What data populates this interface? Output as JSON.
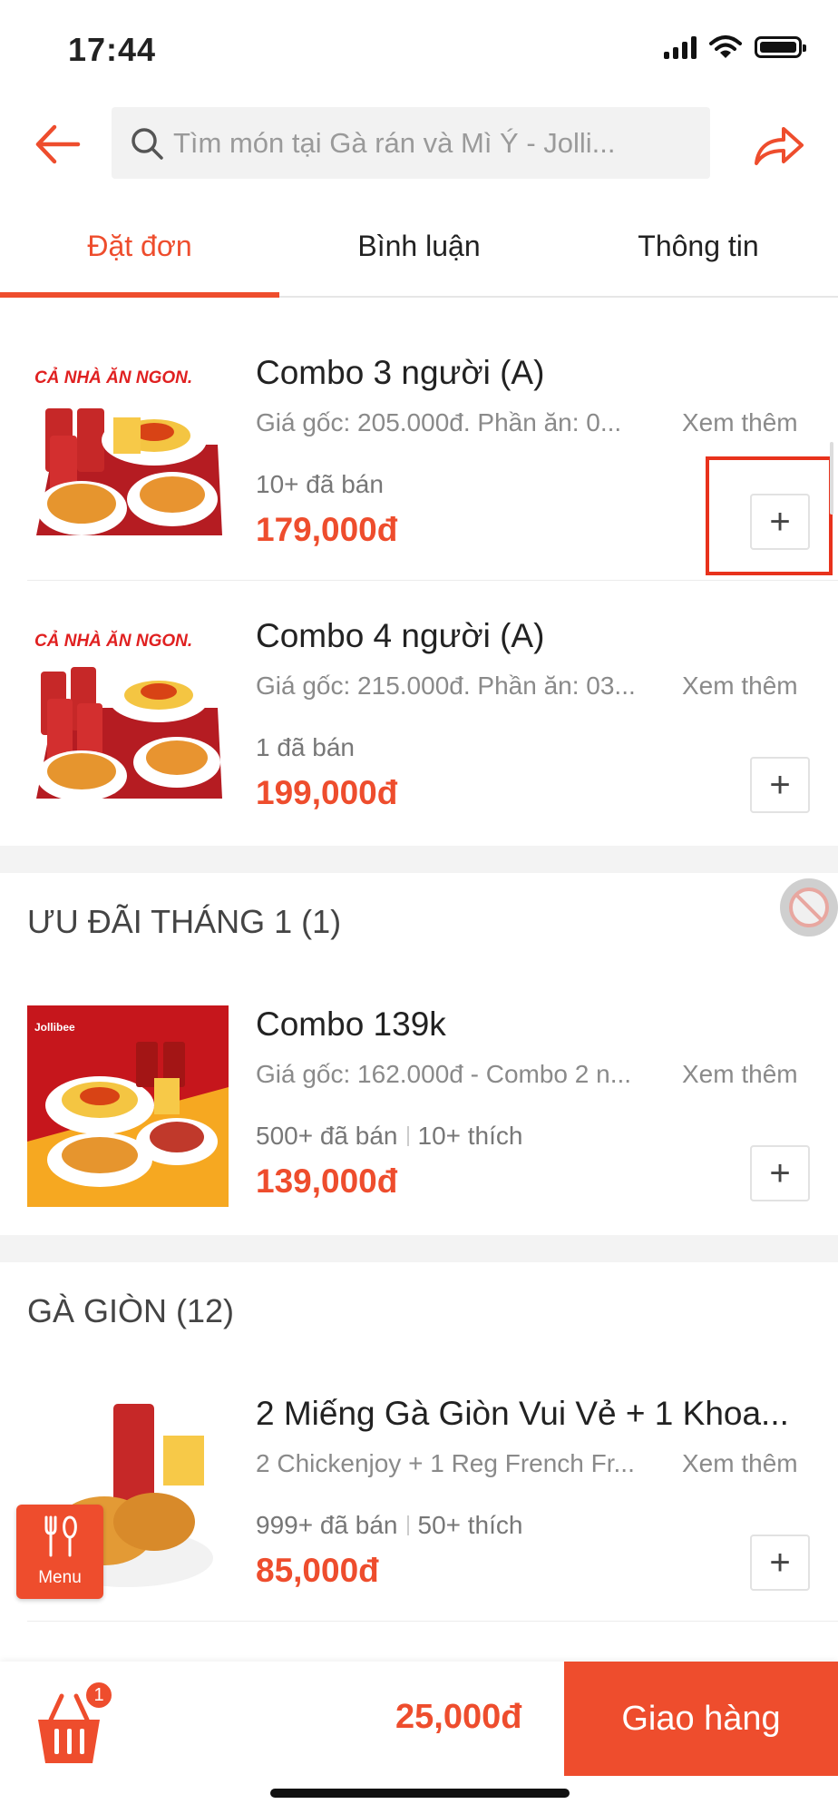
{
  "status": {
    "time": "17:44"
  },
  "search": {
    "placeholder": "Tìm món tại Gà rán và Mì Ý - Jolli..."
  },
  "tabs": [
    {
      "label": "Đặt đơn",
      "active": true
    },
    {
      "label": "Bình luận",
      "active": false
    },
    {
      "label": "Thông tin",
      "active": false
    }
  ],
  "items": [
    {
      "name": "Combo 3 người (A)",
      "desc": "Giá gốc: 205.000đ. Phần ăn: 0...",
      "more": "Xem thêm",
      "sold": "10+ đã bán",
      "likes": "",
      "price": "179,000đ",
      "add": "+"
    },
    {
      "name": "Combo 4 người (A)",
      "desc": "Giá gốc: 215.000đ. Phần ăn: 03...",
      "more": "Xem thêm",
      "sold": "1 đã bán",
      "likes": "",
      "price": "199,000đ",
      "add": "+"
    },
    {
      "name": "Combo 139k",
      "desc": "Giá gốc: 162.000đ - Combo 2 n...",
      "more": "Xem thêm",
      "sold": "500+ đã bán",
      "likes": "10+ thích",
      "price": "139,000đ",
      "add": "+"
    },
    {
      "name": "2 Miếng Gà Giòn Vui Vẻ + 1 Khoa...",
      "desc": " 2 Chickenjoy + 1 Reg French Fr...",
      "more": "Xem thêm",
      "sold": "999+ đã bán",
      "likes": "50+ thích",
      "price": "85,000đ",
      "add": "+"
    }
  ],
  "sections": [
    {
      "title": "ƯU ĐÃI THÁNG 1 (1)"
    },
    {
      "title": "GÀ GIÒN (12)"
    }
  ],
  "thumb_text": {
    "banner": "CẢ NHÀ ĂN NGON.",
    "brand": "Jollibee"
  },
  "menu_button": {
    "label": "Menu"
  },
  "cart": {
    "count": "1",
    "total": "25,000đ"
  },
  "deliver_button": {
    "label": "Giao hàng"
  },
  "colors": {
    "accent": "#ee4d2d",
    "highlight": "#e8321c"
  }
}
